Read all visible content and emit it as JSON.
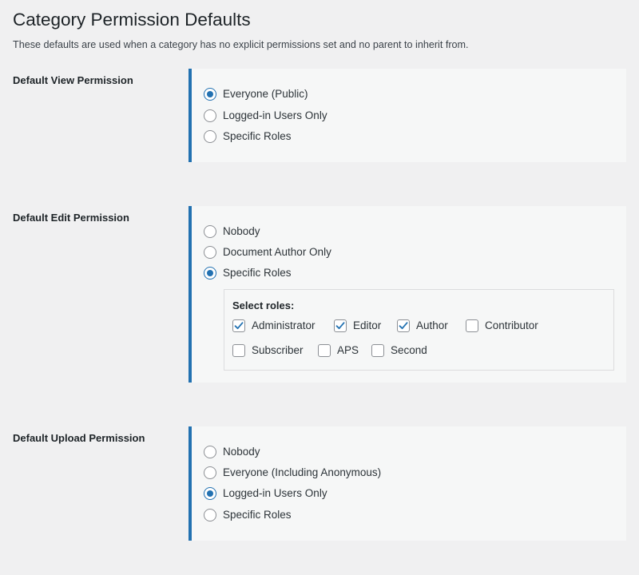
{
  "page": {
    "title": "Category Permission Defaults",
    "description": "These defaults are used when a category has no explicit permissions set and no parent to inherit from."
  },
  "view_permission": {
    "label": "Default View Permission",
    "options": [
      {
        "label": "Everyone (Public)",
        "checked": true
      },
      {
        "label": "Logged-in Users Only",
        "checked": false
      },
      {
        "label": "Specific Roles",
        "checked": false
      }
    ]
  },
  "edit_permission": {
    "label": "Default Edit Permission",
    "options": [
      {
        "label": "Nobody",
        "checked": false
      },
      {
        "label": "Document Author Only",
        "checked": false
      },
      {
        "label": "Specific Roles",
        "checked": true
      }
    ],
    "roles": {
      "title": "Select roles:",
      "items": [
        {
          "label": "Administrator",
          "checked": true
        },
        {
          "label": "Editor",
          "checked": true
        },
        {
          "label": "Author",
          "checked": true
        },
        {
          "label": "Contributor",
          "checked": false
        },
        {
          "label": "Subscriber",
          "checked": false
        },
        {
          "label": "APS",
          "checked": false
        },
        {
          "label": "Second",
          "checked": false
        }
      ]
    }
  },
  "upload_permission": {
    "label": "Default Upload Permission",
    "options": [
      {
        "label": "Nobody",
        "checked": false
      },
      {
        "label": "Everyone (Including Anonymous)",
        "checked": false
      },
      {
        "label": "Logged-in Users Only",
        "checked": true
      },
      {
        "label": "Specific Roles",
        "checked": false
      }
    ]
  },
  "colors": {
    "accent": "#2271b1",
    "background": "#f0f0f1",
    "panel": "#f6f7f7"
  }
}
